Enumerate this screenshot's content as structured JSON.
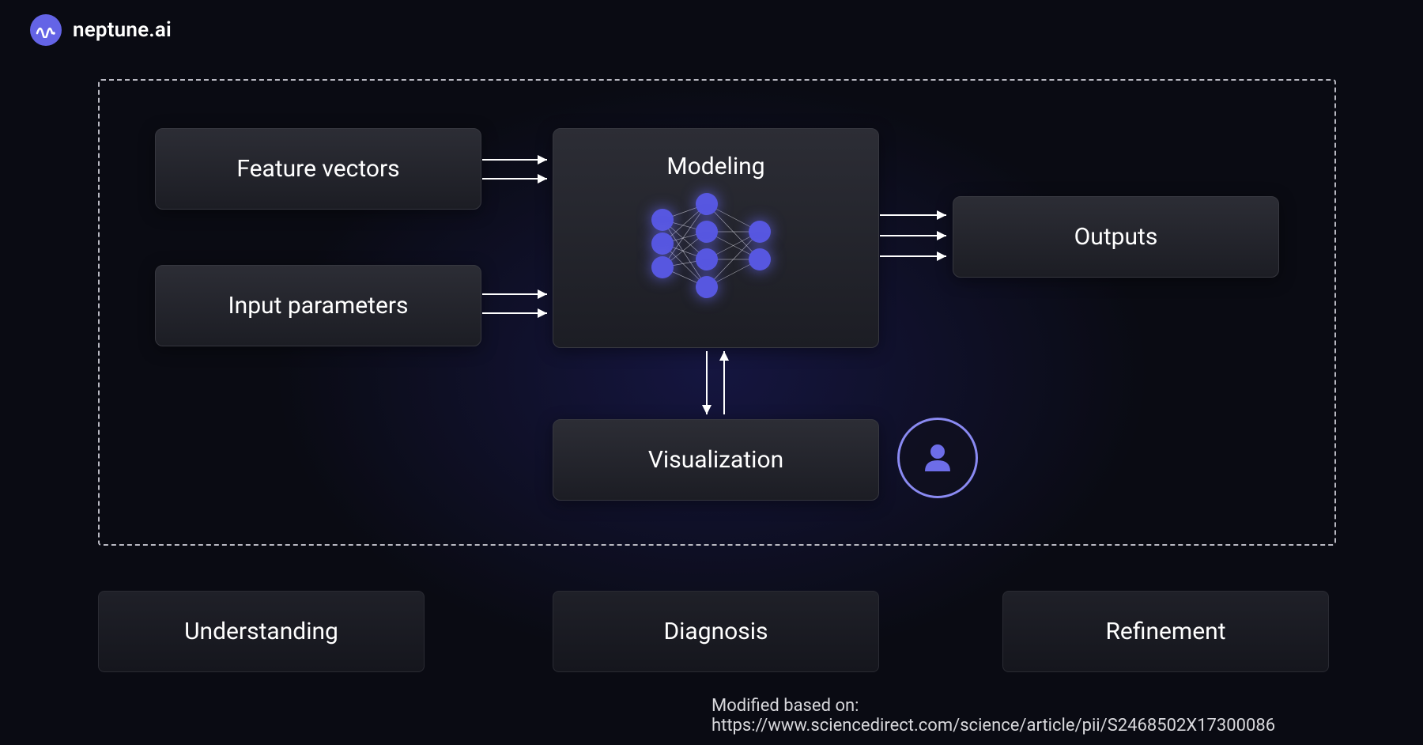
{
  "brand": {
    "name": "neptune.ai"
  },
  "nodes": {
    "feature_vectors": "Feature vectors",
    "input_parameters": "Input parameters",
    "modeling": "Modeling",
    "visualization": "Visualization",
    "outputs": "Outputs"
  },
  "bottom": {
    "understanding": "Understanding",
    "diagnosis": "Diagnosis",
    "refinement": "Refinement"
  },
  "citation": "Modified based on: https://www.sciencedirect.com/science/article/pii/S2468502X17300086"
}
